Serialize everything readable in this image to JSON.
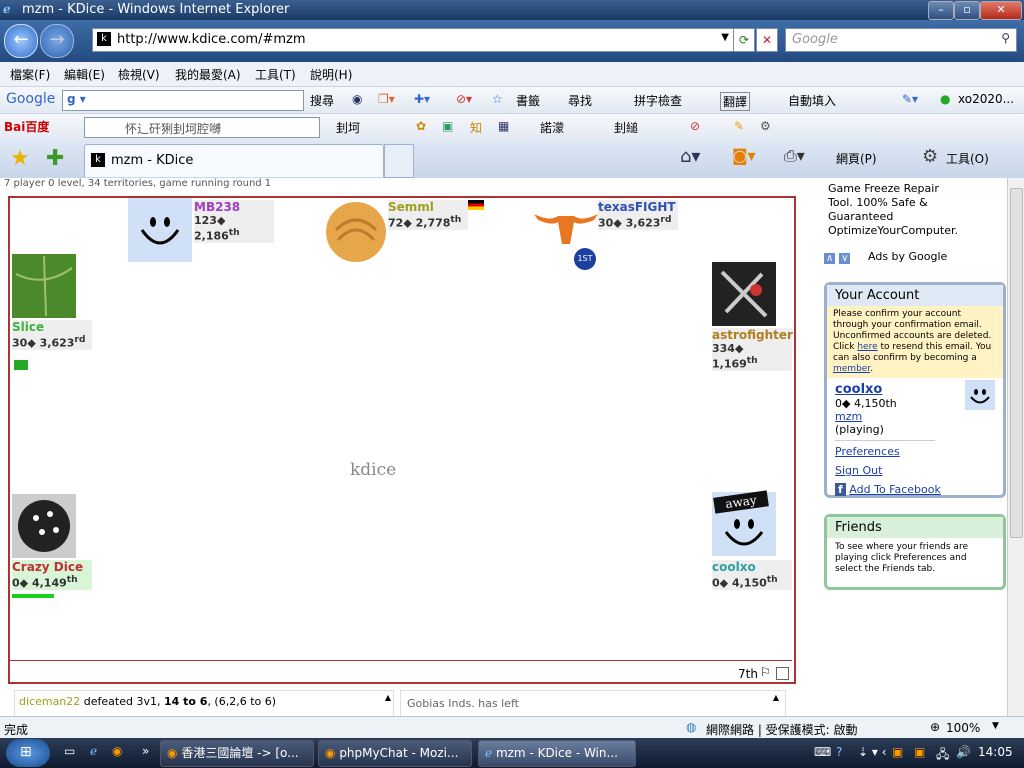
{
  "window": {
    "title": "mzm - KDice - Windows Internet Explorer",
    "url": "http://www.kdice.com/#mzm",
    "search_placeholder": "Google"
  },
  "menu": [
    "檔案(F)",
    "編輯(E)",
    "檢視(V)",
    "我的最愛(A)",
    "工具(T)",
    "說明(H)"
  ],
  "google_toolbar": {
    "logo": "Google",
    "items": [
      "搜尋",
      "書籤",
      "尋找",
      "拼字檢查",
      "翻譯",
      "自動填入",
      "xo2020..."
    ]
  },
  "baidu_toolbar": {
    "logo": "Bai百度",
    "items": [
      "怀辶矸猁刲坷腔嚩",
      "刲坷",
      "諾濛",
      "刲縋"
    ]
  },
  "tab": {
    "label": "mzm - KDice"
  },
  "tab_tools": [
    "網頁(P)",
    "工具(O)"
  ],
  "game": {
    "info": "7 player 0 level, 34 territories, game running round 1",
    "watermark": "kdice",
    "rank_label": "7th",
    "players": [
      {
        "name": "MB238",
        "dice": "123",
        "rank": "2,186",
        "suffix": "th",
        "color": "#a040c0"
      },
      {
        "name": "Semml",
        "dice": "72",
        "rank": "2,778",
        "suffix": "th",
        "color": "#a0a020"
      },
      {
        "name": "texasFIGHT",
        "dice": "30",
        "rank": "3,623",
        "suffix": "rd",
        "color": "#3050b0",
        "badge": "1ST"
      },
      {
        "name": "Slice",
        "dice": "30",
        "rank": "3,623",
        "suffix": "rd",
        "color": "#40b040"
      },
      {
        "name": "astrofighter",
        "dice": "334",
        "rank": "1,169",
        "suffix": "th",
        "color": "#b08020"
      },
      {
        "name": "Crazy Dice",
        "dice": "0",
        "rank": "4,149",
        "suffix": "th",
        "color": "#c03030"
      },
      {
        "name": "coolxo",
        "dice": "0",
        "rank": "4,150",
        "suffix": "th",
        "color": "#30a0a0",
        "tag": "away"
      }
    ],
    "log_left": {
      "actor": "diceman22",
      "verb": "defeated",
      "detail": "3v1,",
      "bold": "14 to 6",
      "tail": ", (6,2,6 to 6)"
    },
    "log_right": "Gobias Inds. has left"
  },
  "sidebar": {
    "ad_lines": [
      "Game Freeze Repair",
      "Tool. 100% Safe &",
      "Guaranteed",
      "OptimizeYourComputer."
    ],
    "ads_by": "Ads by Google",
    "account": {
      "title": "Your Account",
      "notice_1": "Please confirm your account through your confirmation email. Unconfirmed accounts are deleted. Click",
      "notice_here": "here",
      "notice_2": "to resend this email. You can also confirm by becoming a",
      "notice_member": "member",
      "notice_end": ".",
      "user": "coolxo",
      "stats": "0◆  4,150th",
      "room": "mzm",
      "state": "(playing)",
      "links": [
        "Preferences",
        "Sign Out",
        "Add To Facebook"
      ]
    },
    "friends": {
      "title": "Friends",
      "text": "To see where your friends are playing click Preferences and select the Friends tab."
    }
  },
  "status": {
    "left": "完成",
    "zone": "網際網路 | 受保護模式: 啟動",
    "zoom": "100%"
  },
  "taskbar": {
    "tasks": [
      "香港三國論壇 -> [o...",
      "phpMyChat - Mozi...",
      "mzm - KDice - Win..."
    ],
    "clock": "14:05"
  }
}
